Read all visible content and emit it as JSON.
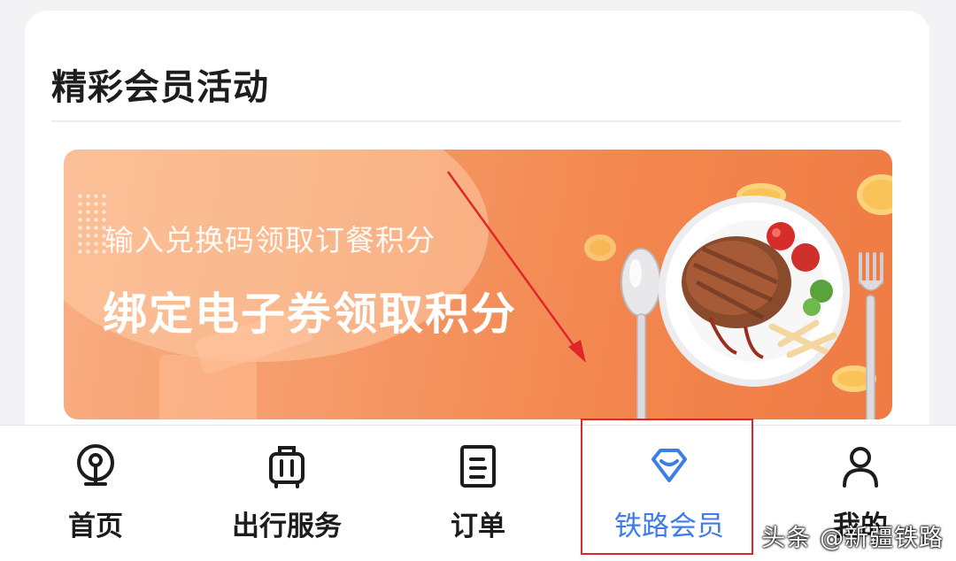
{
  "section": {
    "title": "精彩会员活动"
  },
  "banner": {
    "line1": "输入兑换码领取订餐积分",
    "line2": "绑定电子券领取积分"
  },
  "tabbar": {
    "items": [
      {
        "label": "首页",
        "icon": "railway-logo-icon",
        "active": false
      },
      {
        "label": "出行服务",
        "icon": "luggage-icon",
        "active": false
      },
      {
        "label": "订单",
        "icon": "order-document-icon",
        "active": false
      },
      {
        "label": "铁路会员",
        "icon": "diamond-icon",
        "active": true
      },
      {
        "label": "我的",
        "icon": "person-icon",
        "active": false
      }
    ]
  },
  "colors": {
    "active_tab": "#3e7de8",
    "highlight_box": "#e0262b",
    "banner_orange": "#f3874f"
  },
  "watermark": {
    "text": "头条 @新疆铁路"
  }
}
